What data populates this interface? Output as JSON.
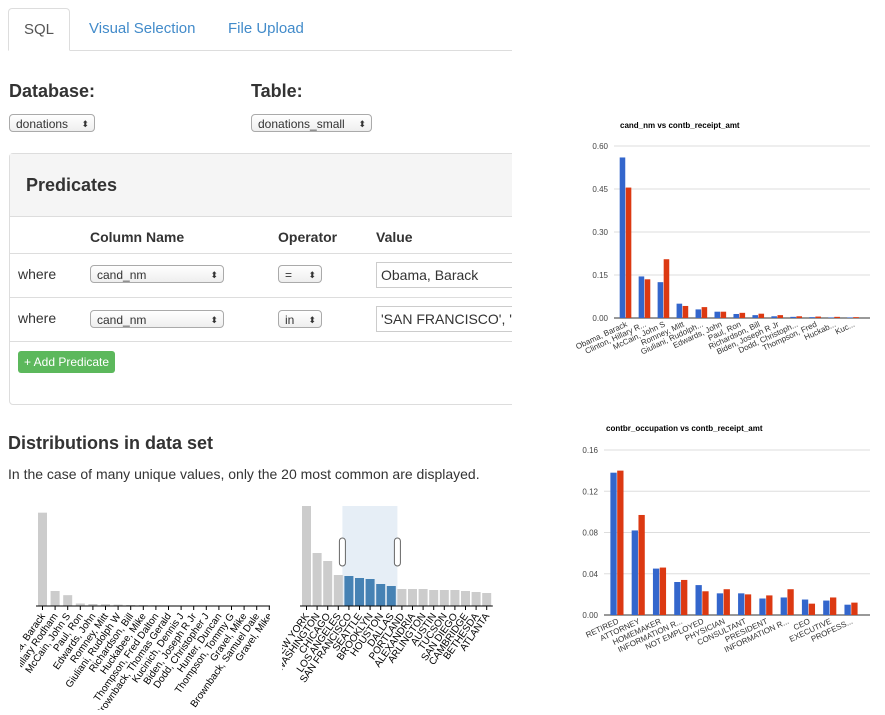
{
  "tabs": [
    {
      "label": "SQL",
      "active": true
    },
    {
      "label": "Visual Selection",
      "active": false
    },
    {
      "label": "File Upload",
      "active": false
    }
  ],
  "database": {
    "label": "Database:",
    "selected": "donations"
  },
  "table": {
    "label": "Table:",
    "selected": "donations_small"
  },
  "predicates": {
    "title": "Predicates",
    "headers": [
      "Column Name",
      "Operator",
      "Value"
    ],
    "rows": [
      {
        "where": "where",
        "column": "cand_nm",
        "operator": "=",
        "value": "Obama, Barack"
      },
      {
        "where": "where",
        "column": "cand_nm",
        "operator": "in",
        "value": "'SAN FRANCISCO', 'SEATTLE'"
      }
    ],
    "add_label": "+ Add Predicate"
  },
  "distributions": {
    "title": "Distributions in data set",
    "subtitle": "In the case of many unique values, only the 20 most common are displayed."
  },
  "colors": {
    "blue": "#3366cc",
    "red": "#dc3912",
    "gray": "#cccccc",
    "selected": "#4682b4",
    "brush": "#e6eef6",
    "tab_link": "#428bca",
    "add_green": "#5cb85c"
  },
  "chart_data": [
    {
      "type": "bar",
      "title": "",
      "categories": [
        "Obama, Barack",
        "Clinton, Hillary Rodham",
        "McCain, John S",
        "Paul, Ron",
        "Edwards, John",
        "Romney, Mitt",
        "Giuliani, Rudolph W",
        "Richardson, Bill",
        "Huckabee, Mike",
        "Thompson, Fred Dalton",
        "Brownback, Thomas Gerald",
        "Kucinich, Dennis J",
        "Biden, Joseph R Jr",
        "Dodd, Christopher J",
        "Hunter, Duncan",
        "Thompson, Tommy G",
        "Gravel, Mike",
        "Brownback, Samuel Dale",
        "Gravel, Mike"
      ],
      "values": [
        0.56,
        0.09,
        0.065,
        0.015,
        0.012,
        0.01,
        0.008,
        0.006,
        0.005,
        0.004,
        0.003,
        0.003,
        0.003,
        0.002,
        0.002,
        0.002,
        0.002,
        0.001,
        0.001
      ],
      "ylim": [
        0,
        0.6
      ]
    },
    {
      "type": "bar",
      "title": "",
      "categories": [
        "NEW YORK",
        "WASHINGTON",
        "CHICAGO",
        "LOS ANGELES",
        "SAN FRANCISCO",
        "SEATTLE",
        "BROOKLYN",
        "HOUSTON",
        "DALLAS",
        "PORTLAND",
        "ALEXANDRIA",
        "ARLINGTON",
        "AUSTIN",
        "TUCSON",
        "SAN DIEGO",
        "CAMBRIDGE",
        "BETHESDA",
        "ATLANTA"
      ],
      "values": [
        100,
        53,
        45,
        31,
        30,
        28,
        27,
        22,
        20,
        17,
        17,
        17,
        16,
        16,
        16,
        15,
        14,
        13
      ],
      "selected": [
        4,
        5,
        6,
        7,
        8
      ],
      "ylim": [
        0,
        100
      ]
    },
    {
      "type": "bar",
      "title": "cand_nm vs contb_receipt_amt",
      "categories": [
        "Obama, Barack",
        "Clinton, Hillary R...",
        "McCain, John S",
        "Romney, Mitt",
        "Giuliani, Rudolph...",
        "Edwards, John",
        "Paul, Ron",
        "Richardson, Bill",
        "Biden, Joseph R Jr",
        "Dodd, Christoph...",
        "Thompson, Fred",
        "Huckab...",
        "Kuc..."
      ],
      "series": [
        {
          "values": [
            0.56,
            0.145,
            0.125,
            0.05,
            0.03,
            0.022,
            0.014,
            0.01,
            0.006,
            0.004,
            0.003,
            0.002,
            0.002
          ]
        },
        {
          "values": [
            0.455,
            0.135,
            0.205,
            0.042,
            0.038,
            0.022,
            0.018,
            0.015,
            0.01,
            0.006,
            0.005,
            0.004,
            0.003
          ]
        }
      ],
      "yticks": [
        "0.00",
        "0.15",
        "0.30",
        "0.45",
        "0.60"
      ],
      "ylim": [
        0,
        0.6
      ]
    },
    {
      "type": "bar",
      "title": "contbr_occupation vs contb_receipt_amt",
      "categories": [
        "RETIRED",
        "ATTORNEY",
        "HOMEMAKER",
        "INFORMATION R...",
        "NOT EMPLOYED",
        "PHYSICIAN",
        "CONSULTANT",
        "PRESIDENT",
        "INFORMATION R...",
        "CEO",
        "EXECUTIVE",
        "PROFESS..."
      ],
      "series": [
        {
          "values": [
            0.138,
            0.082,
            0.045,
            0.032,
            0.029,
            0.021,
            0.021,
            0.016,
            0.017,
            0.015,
            0.014,
            0.01
          ]
        },
        {
          "values": [
            0.14,
            0.097,
            0.046,
            0.034,
            0.023,
            0.025,
            0.02,
            0.019,
            0.025,
            0.011,
            0.017,
            0.012
          ]
        }
      ],
      "yticks": [
        "0.00",
        "0.04",
        "0.08",
        "0.12",
        "0.16"
      ],
      "ylim": [
        0,
        0.16
      ]
    }
  ]
}
